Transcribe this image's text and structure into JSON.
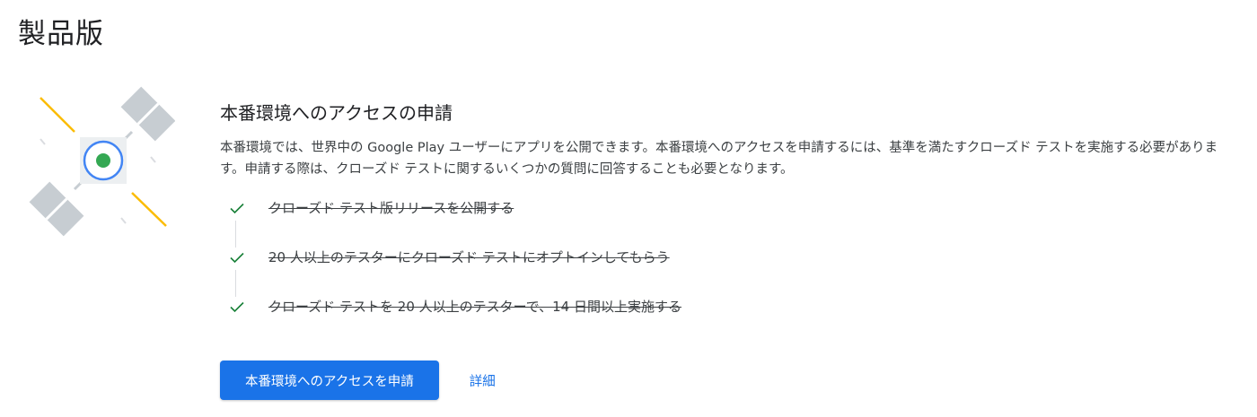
{
  "page": {
    "title": "製品版"
  },
  "production_access": {
    "heading": "本番環境へのアクセスの申請",
    "description": "本番環境では、世界中の Google Play ユーザーにアプリを公開できます。本番環境へのアクセスを申請するには、基準を満たすクローズド テストを実施する必要があります。申請する際は、クローズド テストに関するいくつかの質問に回答することも必要となります。",
    "checklist": [
      {
        "label": "クローズド テスト版リリースを公開する",
        "completed": true,
        "icon": "check-icon"
      },
      {
        "label": "20 人以上のテスターにクローズド テストにオプトインしてもらう",
        "completed": true,
        "icon": "check-icon"
      },
      {
        "label": "クローズド テストを 20 人以上のテスターで、14 日間以上実施する",
        "completed": true,
        "icon": "check-icon"
      }
    ],
    "apply_button": "本番環境へのアクセスを申請",
    "details_link": "詳細"
  },
  "illustration": {
    "icon": "satellite-icon"
  },
  "colors": {
    "accent": "#1a73e8",
    "check": "#188038",
    "satellite_panel": "#c7cdd2",
    "satellite_rays": "#fbbc04",
    "satellite_core": "#34a853",
    "satellite_ring": "#4285f4"
  }
}
